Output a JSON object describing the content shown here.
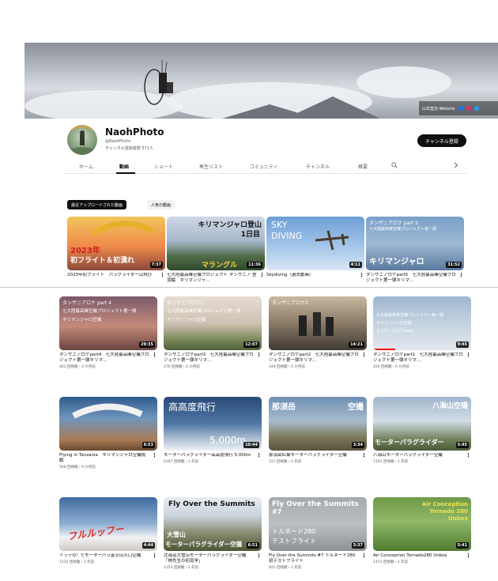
{
  "banner": {
    "link_text": "山本直治 Website",
    "link_colors": [
      "#1877f2",
      "#e1306c",
      "#1da1f2"
    ]
  },
  "channel": {
    "name": "NaohPhoto",
    "handle": "@NaohPhoto",
    "subs": "チャンネル登録者数 571人",
    "subscribe": "チャンネル登録"
  },
  "tabs": [
    "ホーム",
    "動画",
    "ショート",
    "再生リスト",
    "コミュニティ",
    "チャンネル",
    "概要"
  ],
  "tab_active": "動画",
  "tab_icons": [
    "search-icon",
    "chevron-right-icon"
  ],
  "chips": [
    "最近アップロードされた動画",
    "人気の動画"
  ],
  "videos": [
    {
      "title": "2023年初フライト　パラグライダー山飛び",
      "stats": "",
      "duration": "7:37",
      "overlay1": "2023年",
      "overlay2": "初フライト＆初潰れ"
    },
    {
      "title": "七大陸最高峰空撮プロジェクト タンザニア 登頂編　キリマンジャ…",
      "stats": "",
      "duration": "11:36",
      "overlay1": "キリマンジャロ登山",
      "overlay2": "1日目",
      "overlay3": "マラングル"
    },
    {
      "title": "Skydiving（過去動画）",
      "stats": "",
      "duration": "4:11",
      "overlay1": "SKY",
      "overlay2": "DIVING"
    },
    {
      "title": "タンザニアロケpart5　七大陸最高峰空撮プロジェクト第一弾キリマ…",
      "stats": "",
      "duration": "31:52",
      "overlay1": "タンザニアロケ part 5",
      "overlay2": "七大陸最高峰空撮プロジェクト第一弾",
      "overlay3": "キリマンジャロ"
    },
    {
      "title": "タンザニアロケpart4　七大陸最高峰空撮プロジェクト第一弾キリマ…",
      "stats": "463 回視聴・3 か月前",
      "duration": "29:35",
      "overlay1": "タンザニアロケ part 4",
      "overlay2": "七大陸最高峰空撮プロジェクト第一弾",
      "overlay3": "キリマンジャロ空撮"
    },
    {
      "title": "タンザニアロケpart3　七大陸最高峰空撮プロジェクト第一弾キリマ…",
      "stats": "276 回視聴・4 か月前",
      "duration": "12:07",
      "overlay1": "タンザニアロケ3",
      "overlay2": "七大陸最高峰空撮プロジェクト第一弾",
      "overlay3": "キリマンジャロ空撮"
    },
    {
      "title": "タンザニアロケpart2　七大陸最高峰空撮プロジェクト第一弾キリマ…",
      "stats": "349 回視聴・5 か月前",
      "duration": "14:21",
      "overlay1": "タンザニアロケ2",
      "overlay2": "",
      "overlay3": ""
    },
    {
      "title": "タンザニアロケpart1　七大陸最高峰空撮プロジェクト第一弾キリマ…",
      "stats": "426 回視聴・6 か月前",
      "duration": "9:45",
      "overlay1": "七大陸最高峰空撮プロジェクト第一弾",
      "overlay2": "キリマンジャロ空撮",
      "overlay3": "タンザニアロケpart1"
    },
    {
      "title": "Flying in Tanzania　キリマンジャロ空撮挑戦",
      "stats": "568 回視聴・9 か月前",
      "duration": "6:53",
      "overlay1": "",
      "overlay2": "",
      "overlay3": ""
    },
    {
      "title": "モーターパラグライダー高高度飛行 5,000m",
      "stats": "6397 回視聴・1 年前",
      "duration": "10:44",
      "overlay1": "高高度飛行",
      "overlay2": "5,000m"
    },
    {
      "title": "那須岳紅葉モーターパラグライダー空撮",
      "stats": "317 回視聴・1 年前",
      "duration": "3:34",
      "overlay1": "那須岳",
      "overlay2": "空撮"
    },
    {
      "title": "八海山モーターパラグライダー空撮",
      "stats": "1101 回視聴・1 年前",
      "duration": "5:45",
      "overlay1": "八海山空撮",
      "overlay2": "モーターパラグライダー"
    },
    {
      "title": "イッテQ！でモーターパラ富士山火口空撮",
      "stats": "1532 回視聴・1 年前",
      "duration": "4:44",
      "overlay1": "フルルッフー",
      "overlay2": ""
    },
    {
      "title": "北海道大雪山モーターパラグライダー空撮「林先生の初耳学」",
      "stats": "1353 回視聴・2 年前",
      "duration": "6:51",
      "overlay1": "Fly Over the Summits",
      "overlay2": "大雪山",
      "overlay3": "モーターパラグライダー空撮"
    },
    {
      "title": "Fly Over the Summits #7 トルネード280 初テストフライト",
      "stats": "922 回視聴・2 年前",
      "duration": "3:37",
      "overlay1": "Fly Over the Summits",
      "overlay2": "#7",
      "overlay3": "トルネード280",
      "overlay4": "テストフライト"
    },
    {
      "title": "Air Conceprion Tornado280 Unbox",
      "stats": "1472 回視聴・2 年前",
      "duration": "5:41",
      "overlay1": "Air Conception",
      "overlay2": "Tornado 280",
      "overlay3": "Unbox"
    }
  ]
}
